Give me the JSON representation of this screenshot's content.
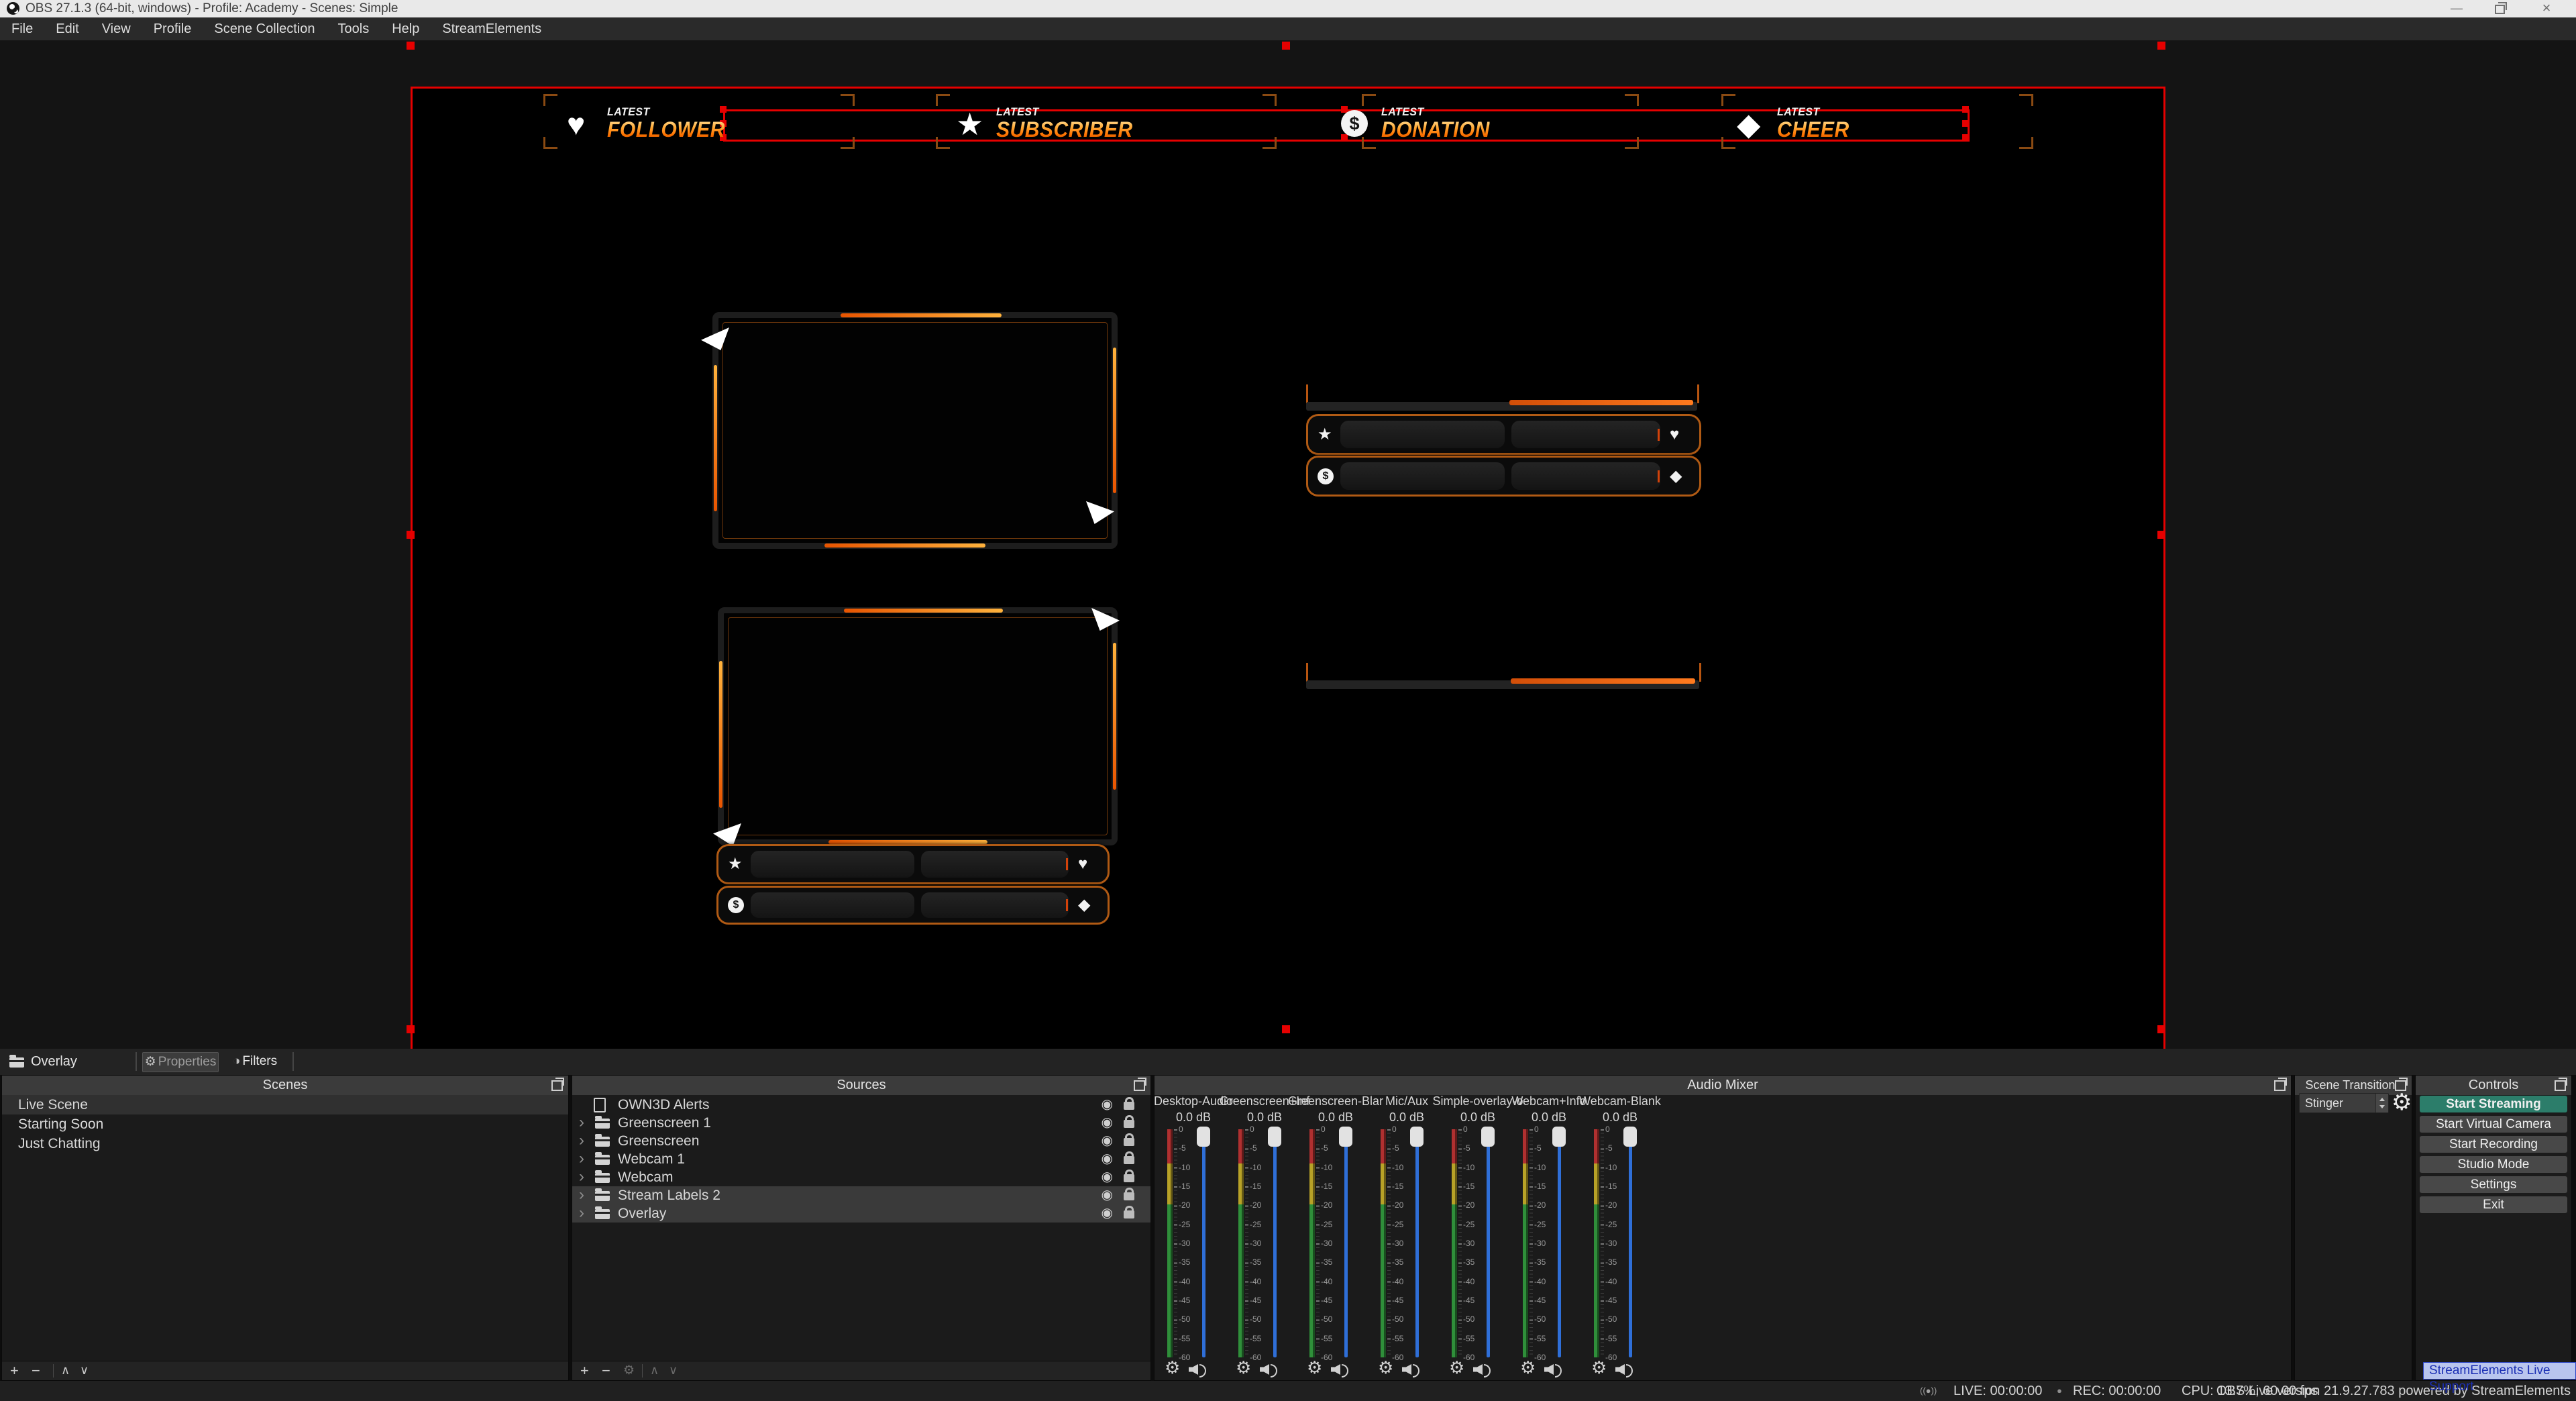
{
  "window": {
    "title": "OBS 27.1.3 (64-bit, windows) - Profile: Academy - Scenes: Simple",
    "minimize_glyph": "—",
    "close_glyph": "×"
  },
  "menu": {
    "items": [
      "File",
      "Edit",
      "View",
      "Profile",
      "Scene Collection",
      "Tools",
      "Help",
      "StreamElements"
    ]
  },
  "icons": {
    "heart": "♥",
    "star": "★",
    "diamond": "◆",
    "dollar": "$",
    "gear": "⚙",
    "chevron": "›",
    "eye": "◉",
    "plus": "+",
    "minus": "−",
    "up": "∧",
    "down": "∨",
    "filters": "◑",
    "live": "((●))",
    "rec_dot": "●"
  },
  "preview": {
    "alert_labels": [
      {
        "icon": "heart-icon",
        "title": "LATEST",
        "value": "FOLLOWER"
      },
      {
        "icon": "star-icon",
        "title": "LATEST",
        "value": "SUBSCRIBER"
      },
      {
        "icon": "dollar-icon",
        "title": "LATEST",
        "value": "DONATION"
      },
      {
        "icon": "diamond-icon",
        "title": "LATEST",
        "value": "CHEER"
      }
    ],
    "label_bar_rows": [
      {
        "left_icon": "star-icon",
        "right_icon": "heart-icon"
      },
      {
        "left_icon": "dollar-icon",
        "right_icon": "diamond-icon"
      }
    ]
  },
  "dock_strip": {
    "source_label": "Overlay",
    "properties_button": "Properties",
    "filters_button": "Filters"
  },
  "scenes": {
    "header": "Scenes",
    "items": [
      "Live Scene",
      "Starting Soon",
      "Just Chatting"
    ],
    "selected": "Live Scene"
  },
  "sources": {
    "header": "Sources",
    "rows": [
      {
        "name": "OWN3D Alerts",
        "type": "file",
        "selected": false
      },
      {
        "name": "Greenscreen 1",
        "type": "group",
        "selected": false
      },
      {
        "name": "Greenscreen",
        "type": "group",
        "selected": false
      },
      {
        "name": "Webcam 1",
        "type": "group",
        "selected": false
      },
      {
        "name": "Webcam",
        "type": "group",
        "selected": false
      },
      {
        "name": "Stream Labels 2",
        "type": "group",
        "selected": true
      },
      {
        "name": "Overlay",
        "type": "group",
        "selected": true
      }
    ]
  },
  "mixer": {
    "header": "Audio Mixer",
    "channels": [
      {
        "name": "Desktop-Audio",
        "volume": "0.0 dB"
      },
      {
        "name": "Greenscreen+Inf",
        "volume": "0.0 dB"
      },
      {
        "name": "Greenscreen-Blar",
        "volume": "0.0 dB"
      },
      {
        "name": "Mic/Aux",
        "volume": "0.0 dB"
      },
      {
        "name": "Simple-overlay-o",
        "volume": "0.0 dB"
      },
      {
        "name": "Webcam+Info",
        "volume": "0.0 dB"
      },
      {
        "name": "Webcam-Blank",
        "volume": "0.0 dB"
      }
    ],
    "scale_ticks": [
      0,
      -5,
      -10,
      -15,
      -20,
      -25,
      -30,
      -35,
      -40,
      -45,
      -50,
      -55,
      -60
    ]
  },
  "transitions": {
    "header": "Scene Transitions",
    "selected": "Stinger"
  },
  "controls": {
    "header": "Controls",
    "buttons": [
      "Start Streaming",
      "Start Virtual Camera",
      "Start Recording",
      "Studio Mode",
      "Settings",
      "Exit"
    ]
  },
  "status": {
    "live_label": "LIVE: 00:00:00",
    "rec_label": "REC: 00:00:00",
    "cpu_label": "CPU: 13.7%, 60.00 fps",
    "version_label": "OBS.Live version 21.9.27.783 powered by StreamElements",
    "support_button": "StreamElements Live Support"
  },
  "colors": {
    "accent_orange": "#ff7a1a",
    "selection_red": "#e60000",
    "streaming_teal": "#2c7d6a",
    "slider_blue": "#2f6fd8",
    "meter_red": "#b03030",
    "meter_yellow": "#b8a227",
    "meter_green": "#2f8f3a"
  }
}
